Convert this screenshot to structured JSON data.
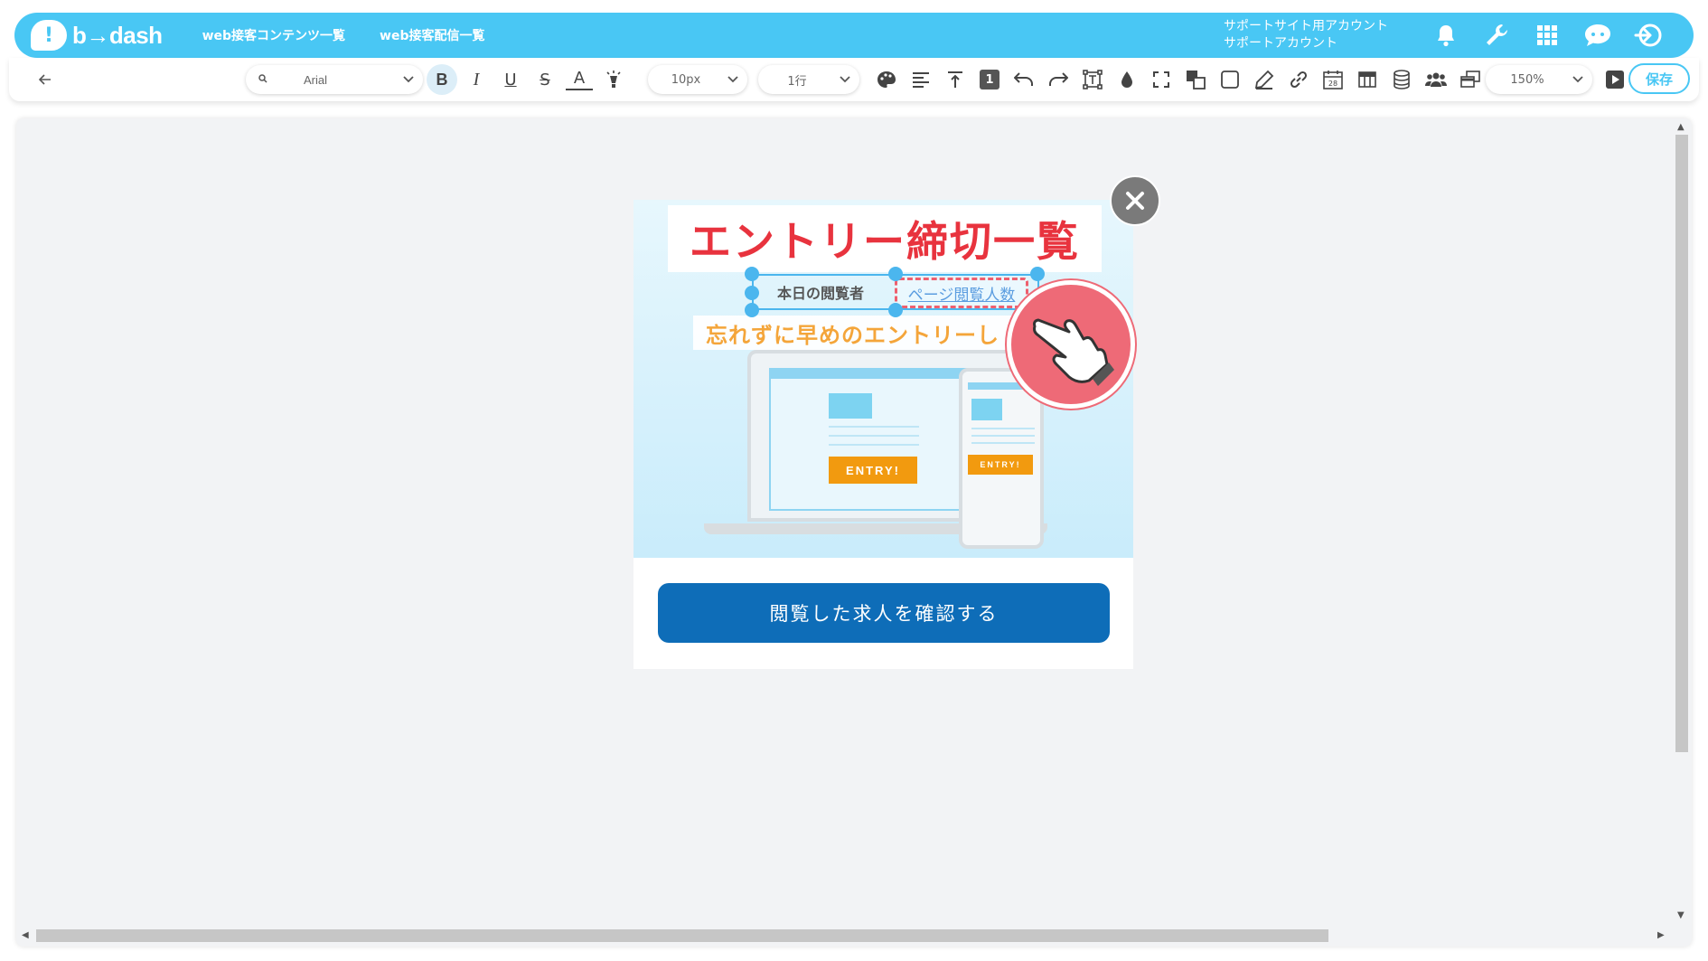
{
  "header": {
    "logo_text": "b→dash",
    "nav": [
      "web接客コンテンツ一覧",
      "web接客配信一覧"
    ],
    "account_line1": "サポートサイト用アカウント",
    "account_line2": "サポートアカウント",
    "icons": [
      "bell-icon",
      "wrench-icon",
      "grid-icon",
      "chat-icon",
      "logout-icon"
    ]
  },
  "toolbar": {
    "back_icon": "arrow-left-icon",
    "font_family": "Arial",
    "font_size": "10px",
    "line_spacing": "1行",
    "zoom": "150%",
    "save_label": "保存",
    "list_badge": "1",
    "calendar_num": "28"
  },
  "popup": {
    "title": "エントリー締切一覧",
    "viewer_label": "本日の閲覧者",
    "page_count_tag": "ページ閲覧人数",
    "subtitle": "忘れずに早めのエントリーし",
    "entry_label": "ENTRY!",
    "cta_label": "閲覧した求人を確認する"
  },
  "colors": {
    "accent": "#49c7f4",
    "title_red": "#e8333e",
    "subtitle_orange": "#f4a53a",
    "cta_blue": "#0e6db8",
    "entry_orange": "#f29a0f"
  }
}
